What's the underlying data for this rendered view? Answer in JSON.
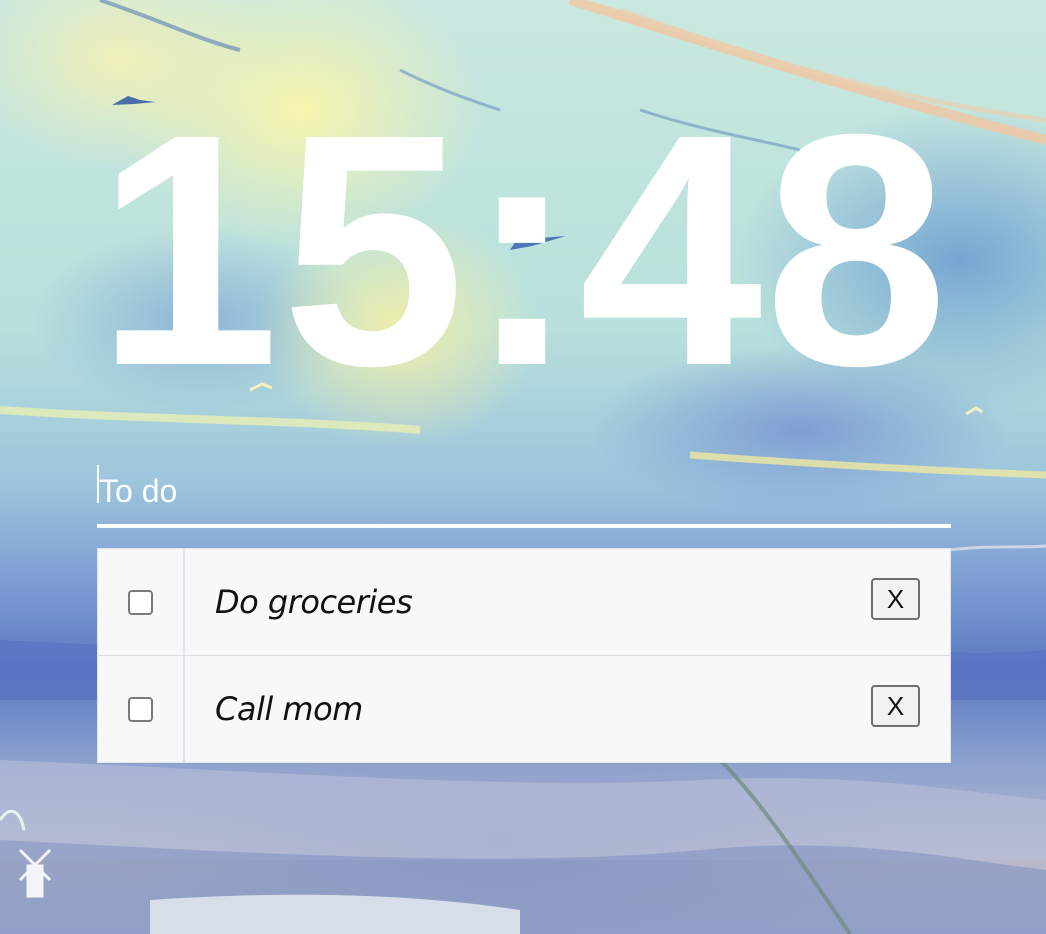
{
  "clock": {
    "time": "15:48"
  },
  "todo": {
    "input_placeholder": "To do",
    "items": [
      {
        "label": "Do groceries",
        "checked": false,
        "delete_label": "X"
      },
      {
        "label": "Call mom",
        "checked": false,
        "delete_label": "X"
      }
    ]
  },
  "colors": {
    "clock_text": "#ffffff",
    "list_background": "#f8f8f8",
    "input_underline": "#ffffff"
  }
}
